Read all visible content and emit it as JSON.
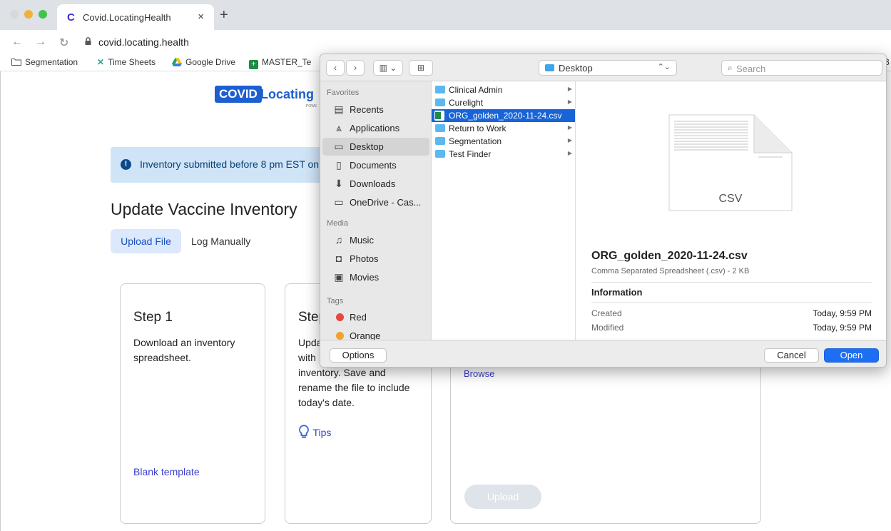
{
  "browser": {
    "tab_title": "Covid.LocatingHealth",
    "tab_favicon": "C",
    "url": "covid.locating.health",
    "bookmarks": [
      "Segmentation",
      "Time Sheets",
      "Google Drive",
      "MASTER_Te",
      "B"
    ]
  },
  "page": {
    "logo_badge": "COVID",
    "logo_text": "Locating",
    "logo_sub": "POWE",
    "banner_text": "Inventory submitted before 8 pm EST on",
    "title": "Update Vaccine Inventory",
    "tabs": {
      "upload": "Upload File",
      "manual": "Log Manually"
    },
    "step1": {
      "title": "Step 1",
      "text": "Download an inventory spreadsheet.",
      "link": "Blank template"
    },
    "step2": {
      "title": "Step",
      "lines": [
        "Upda",
        "with ",
        "inventory. Save and",
        "rename the file to include",
        "today's date."
      ],
      "tips": "Tips"
    },
    "step3": {
      "browse": "Browse",
      "upload": "Upload"
    }
  },
  "dialog": {
    "location": "Desktop",
    "search_placeholder": "Search",
    "sections": {
      "favorites": "Favorites",
      "media": "Media",
      "tags": "Tags"
    },
    "favorites": [
      "Recents",
      "Applications",
      "Desktop",
      "Documents",
      "Downloads",
      "OneDrive - Cas..."
    ],
    "media": [
      "Music",
      "Photos",
      "Movies"
    ],
    "tags": [
      "Red",
      "Orange"
    ],
    "tag_colors": [
      "#e5483e",
      "#f2a12c"
    ],
    "files": [
      {
        "name": "Clinical Admin",
        "kind": "folder"
      },
      {
        "name": "Curelight",
        "kind": "folder"
      },
      {
        "name": "ORG_golden_2020-11-24.csv",
        "kind": "file"
      },
      {
        "name": "Return to Work",
        "kind": "folder"
      },
      {
        "name": "Segmentation",
        "kind": "folder"
      },
      {
        "name": "Test Finder",
        "kind": "folder"
      }
    ],
    "preview": {
      "doc_label": "CSV",
      "filename": "ORG_golden_2020-11-24.csv",
      "filetype": "Comma Separated Spreadsheet (.csv) - 2 KB",
      "info_heading": "Information",
      "created_label": "Created",
      "created_value": "Today, 9:59 PM",
      "modified_label": "Modified",
      "modified_value": "Today, 9:59 PM"
    },
    "buttons": {
      "options": "Options",
      "cancel": "Cancel",
      "open": "Open"
    }
  },
  "colors": {
    "accent": "#1d5fd0",
    "selection": "#1864d6",
    "banner": "#cfe4f7"
  }
}
